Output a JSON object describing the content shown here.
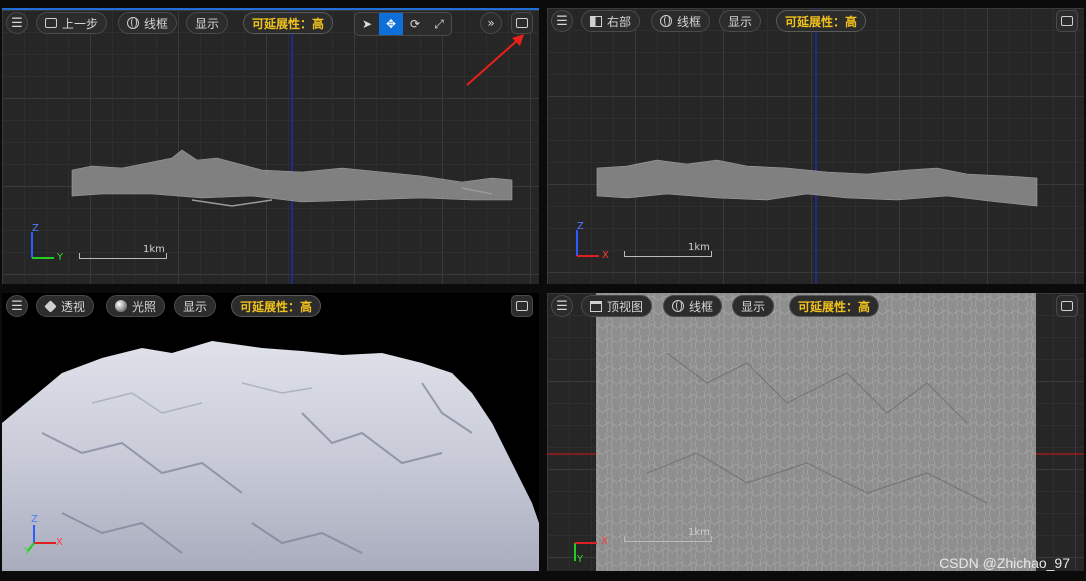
{
  "viewports": {
    "front": {
      "menu_icon": "hamburger-icon",
      "view_label": "上一步",
      "wireframe_label": "线框",
      "show_label": "显示",
      "scalability_label": "可延展性：高",
      "tools": [
        "select-icon",
        "move-icon",
        "rotate-icon",
        "scale-icon"
      ],
      "more_icon": "double-chevron-icon",
      "maximize_icon": "maximize-icon",
      "scale_text": "1km",
      "axis_v": "Z",
      "axis_h": "Y"
    },
    "right": {
      "view_label": "右部",
      "wireframe_label": "线框",
      "show_label": "显示",
      "scalability_label": "可延展性：高",
      "scale_text": "1km",
      "axis_v": "Z",
      "axis_h": "X"
    },
    "perspective": {
      "view_label": "透视",
      "lighting_label": "光照",
      "show_label": "显示",
      "scalability_label": "可延展性：高",
      "axis_v": "Z",
      "axis_h": "X",
      "axis_d": "Y"
    },
    "top": {
      "view_label": "顶视图",
      "wireframe_label": "线框",
      "show_label": "显示",
      "scalability_label": "可延展性：高",
      "scale_text": "1km",
      "axis_v": "Y",
      "axis_h": "X"
    }
  },
  "colors": {
    "accent_blue": "#0f6fd8",
    "scalability_yellow": "#f2c21c",
    "annotation_red": "#e8201a"
  },
  "watermark": "CSDN @Zhichao_97"
}
